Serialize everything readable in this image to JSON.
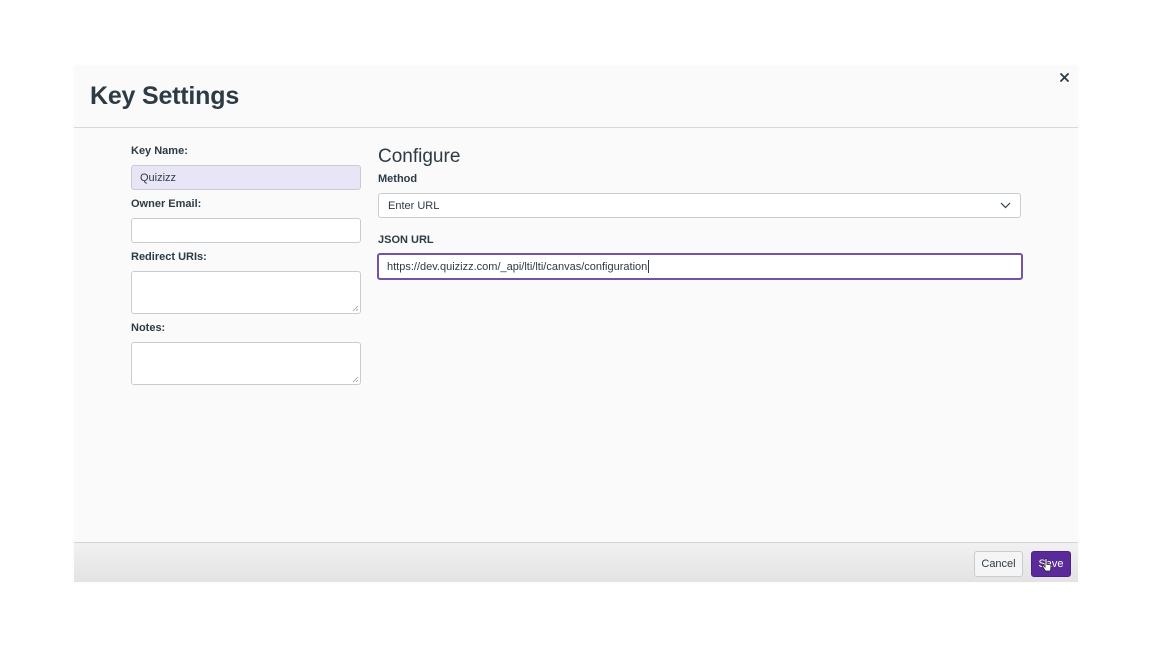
{
  "dialog": {
    "title": "Key Settings",
    "close_icon": "close-icon"
  },
  "form": {
    "key_name": {
      "label": "Key Name:",
      "value": "Quizizz"
    },
    "owner_email": {
      "label": "Owner Email:",
      "value": ""
    },
    "redirect_uris": {
      "label": "Redirect URIs:",
      "value": ""
    },
    "notes": {
      "label": "Notes:",
      "value": ""
    }
  },
  "configure": {
    "heading": "Configure",
    "method": {
      "label": "Method",
      "selected": "Enter URL"
    },
    "json_url": {
      "label": "JSON URL",
      "value": "https://dev.quizizz.com/_api/lti/lti/canvas/configuration"
    }
  },
  "footer": {
    "cancel_label": "Cancel",
    "save_label": "Save"
  },
  "colors": {
    "accent": "#5b2a9a",
    "focus_border": "#7253a8",
    "filled_input": "#e8e6f6"
  }
}
